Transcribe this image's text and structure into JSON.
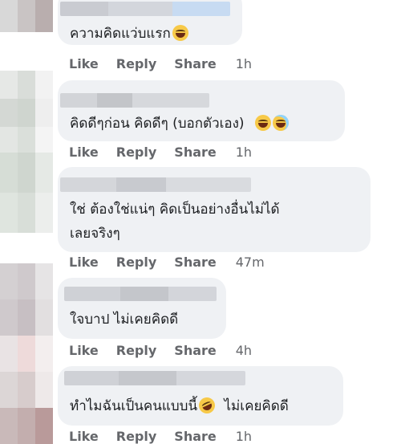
{
  "comments": [
    {
      "text_lines": [
        "ความคิดแว่บแรก"
      ],
      "emojis": [
        "laugh-with-tears-emoji"
      ],
      "actions": {
        "like": "Like",
        "reply": "Reply",
        "share": "Share",
        "time": "1h"
      }
    },
    {
      "text_lines": [
        "คิดดีๆก่อน คิดดีๆ (บอกตัวเอง)"
      ],
      "emojis": [
        "grin-emoji",
        "grin-sweat-emoji"
      ],
      "actions": {
        "like": "Like",
        "reply": "Reply",
        "share": "Share",
        "time": "1h"
      }
    },
    {
      "text_lines": [
        "ใช่ ต้องใช่แน่ๆ คิดเป็นอย่างอื่นไม่ได้",
        "เลยจริงๆ"
      ],
      "emojis": [],
      "actions": {
        "like": "Like",
        "reply": "Reply",
        "share": "Share",
        "time": "47m"
      }
    },
    {
      "text_lines": [
        "ใจบาป ไม่เคยคิดดี"
      ],
      "emojis": [],
      "actions": {
        "like": "Like",
        "reply": "Reply",
        "share": "Share",
        "time": "4h"
      }
    },
    {
      "text_lines": [
        "ทำไมฉันเป็นคนแบบนี้",
        "ไม่เคยคิดดี"
      ],
      "emojis": [
        "rolling-on-floor-laughing-emoji"
      ],
      "actions": {
        "like": "Like",
        "reply": "Reply",
        "share": "Share",
        "time": "1h"
      }
    }
  ],
  "colors": {
    "bubble": "#eff1f4",
    "action_text": "#65676b",
    "comment_text": "#1c1e21"
  }
}
